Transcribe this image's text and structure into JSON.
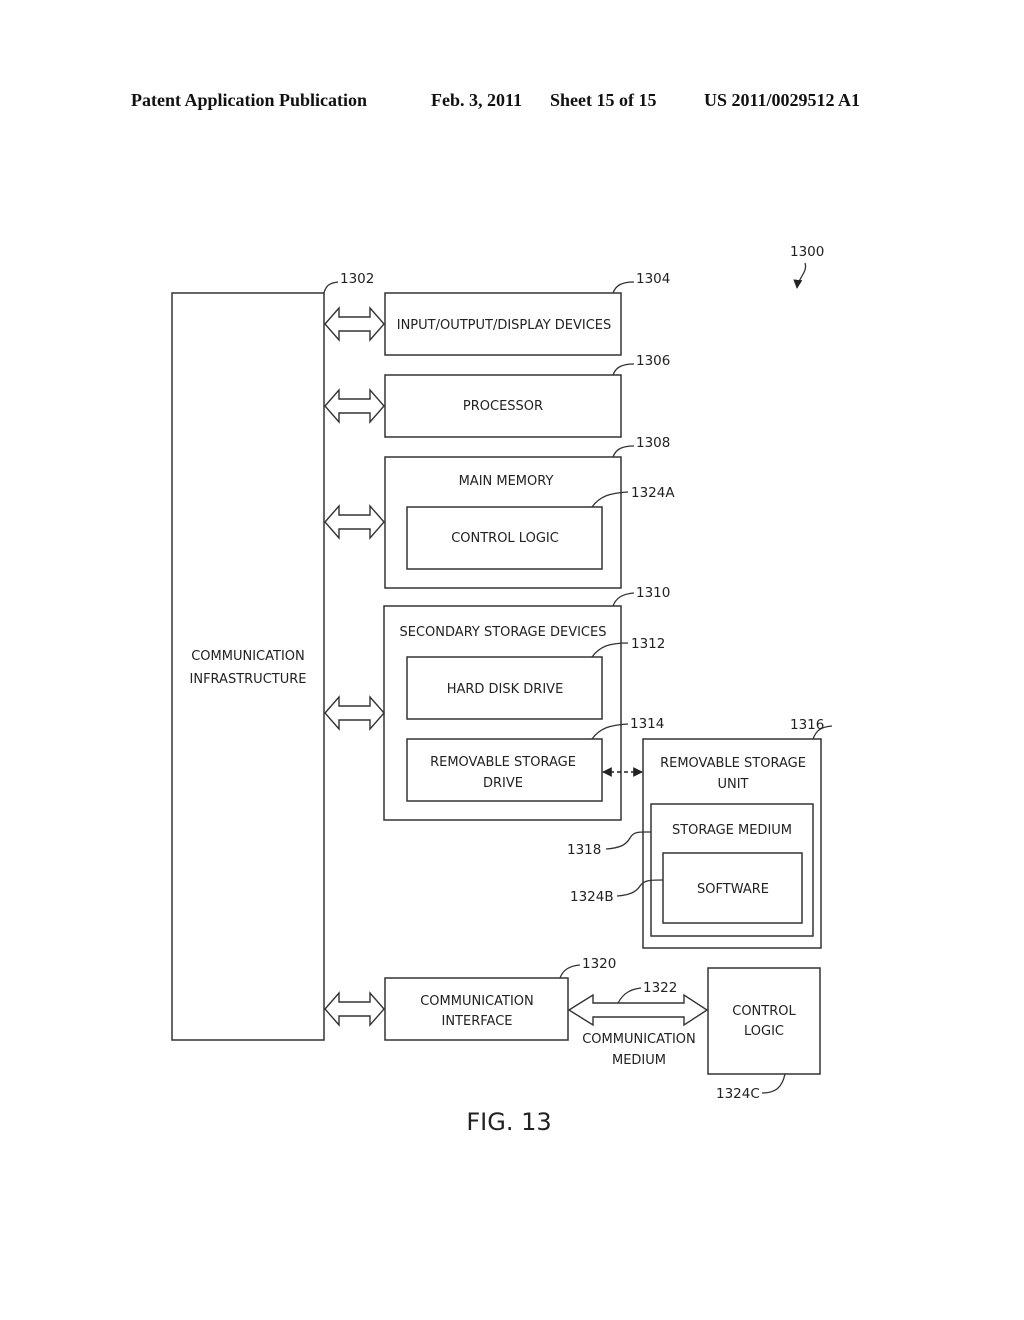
{
  "header": {
    "publication": "Patent Application Publication",
    "date": "Feb. 3, 2011",
    "sheet": "Sheet 15 of 15",
    "number": "US 2011/0029512 A1"
  },
  "figure": {
    "caption": "FIG. 13",
    "ref_main": "1300",
    "blocks": {
      "comm_infra": {
        "ref": "1302",
        "line1": "COMMUNICATION",
        "line2": "INFRASTRUCTURE"
      },
      "io": {
        "ref": "1304",
        "label": "INPUT/OUTPUT/DISPLAY DEVICES"
      },
      "processor": {
        "ref": "1306",
        "label": "PROCESSOR"
      },
      "main_memory": {
        "ref": "1308",
        "label": "MAIN MEMORY"
      },
      "control_logic_a": {
        "ref": "1324A",
        "label": "CONTROL LOGIC"
      },
      "secondary": {
        "ref": "1310",
        "label": "SECONDARY STORAGE DEVICES"
      },
      "hdd": {
        "ref": "1312",
        "label": "HARD DISK DRIVE"
      },
      "rsd": {
        "ref": "1314",
        "line1": "REMOVABLE STORAGE",
        "line2": "DRIVE"
      },
      "rsu": {
        "ref": "1316",
        "line1": "REMOVABLE STORAGE",
        "line2": "UNIT"
      },
      "storage_medium": {
        "ref": "1318",
        "label": "STORAGE MEDIUM"
      },
      "software": {
        "ref": "1324B",
        "label": "SOFTWARE"
      },
      "comm_interface": {
        "ref": "1320",
        "line1": "COMMUNICATION",
        "line2": "INTERFACE"
      },
      "comm_medium": {
        "ref": "1322",
        "line1": "COMMUNICATION",
        "line2": "MEDIUM"
      },
      "control_logic_c": {
        "ref": "1324C",
        "line1": "CONTROL",
        "line2": "LOGIC"
      }
    }
  }
}
